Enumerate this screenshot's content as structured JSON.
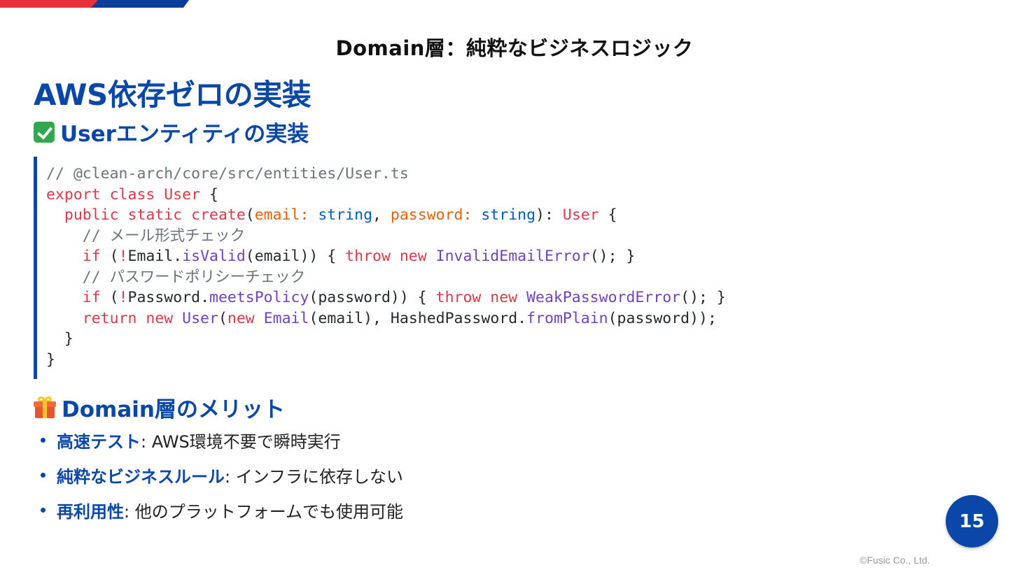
{
  "header": {
    "title": "Domain層：純粋なビジネスロジック"
  },
  "main": {
    "title": "AWS依存ゼロの実装"
  },
  "section_entity": {
    "title": "Userエンティティの実装"
  },
  "code": {
    "lines": [
      [
        {
          "t": "// @clean-arch/core/src/entities/User.ts",
          "c": "comment"
        }
      ],
      [
        {
          "t": "export class User",
          "c": "kw"
        },
        {
          "t": " {",
          "c": "plain"
        }
      ],
      [
        {
          "t": "  public static create",
          "c": "kw"
        },
        {
          "t": "(",
          "c": "plain"
        },
        {
          "t": "email: ",
          "c": "param"
        },
        {
          "t": "string",
          "c": "type"
        },
        {
          "t": ", ",
          "c": "plain"
        },
        {
          "t": "password: ",
          "c": "param"
        },
        {
          "t": "string",
          "c": "type"
        },
        {
          "t": "): ",
          "c": "plain"
        },
        {
          "t": "User",
          "c": "kw"
        },
        {
          "t": " {",
          "c": "plain"
        }
      ],
      [
        {
          "t": "    // メール形式チェック",
          "c": "comment"
        }
      ],
      [
        {
          "t": "    if",
          "c": "kw"
        },
        {
          "t": " (",
          "c": "plain"
        },
        {
          "t": "!",
          "c": "kw"
        },
        {
          "t": "Email.",
          "c": "plain"
        },
        {
          "t": "isValid",
          "c": "fn"
        },
        {
          "t": "(email)) { ",
          "c": "plain"
        },
        {
          "t": "throw new",
          "c": "kw"
        },
        {
          "t": " ",
          "c": "plain"
        },
        {
          "t": "InvalidEmailError",
          "c": "fn"
        },
        {
          "t": "(); }",
          "c": "plain"
        }
      ],
      [
        {
          "t": "    // パスワードポリシーチェック",
          "c": "comment"
        }
      ],
      [
        {
          "t": "    if",
          "c": "kw"
        },
        {
          "t": " (",
          "c": "plain"
        },
        {
          "t": "!",
          "c": "kw"
        },
        {
          "t": "Password.",
          "c": "plain"
        },
        {
          "t": "meetsPolicy",
          "c": "fn"
        },
        {
          "t": "(password)) { ",
          "c": "plain"
        },
        {
          "t": "throw new",
          "c": "kw"
        },
        {
          "t": " ",
          "c": "plain"
        },
        {
          "t": "WeakPasswordError",
          "c": "fn"
        },
        {
          "t": "(); }",
          "c": "plain"
        }
      ],
      [
        {
          "t": "    return new",
          "c": "kw"
        },
        {
          "t": " ",
          "c": "plain"
        },
        {
          "t": "User",
          "c": "fn"
        },
        {
          "t": "(",
          "c": "plain"
        },
        {
          "t": "new",
          "c": "kw"
        },
        {
          "t": " ",
          "c": "plain"
        },
        {
          "t": "Email",
          "c": "fn"
        },
        {
          "t": "(email), HashedPassword.",
          "c": "plain"
        },
        {
          "t": "fromPlain",
          "c": "fn"
        },
        {
          "t": "(password));",
          "c": "plain"
        }
      ],
      [
        {
          "t": "  }",
          "c": "plain"
        }
      ],
      [
        {
          "t": "}",
          "c": "plain"
        }
      ]
    ]
  },
  "section_merit": {
    "title": "Domain層のメリット"
  },
  "merits": [
    {
      "term": "高速テスト",
      "desc": ": AWS環境不要で瞬時実行"
    },
    {
      "term": "純粋なビジネスルール",
      "desc": ": インフラに依存しない"
    },
    {
      "term": "再利用性",
      "desc": ": 他のプラットフォームでも使用可能"
    }
  ],
  "footer": {
    "page_number": "15",
    "copyright": "©Fusic Co., Ltd."
  },
  "icons": {
    "section_entity_icon": "check-mark-icon",
    "section_merit_icon": "gift-icon"
  },
  "colors": {
    "accent": "#0a47a8",
    "brand_red": "#e8303a"
  }
}
